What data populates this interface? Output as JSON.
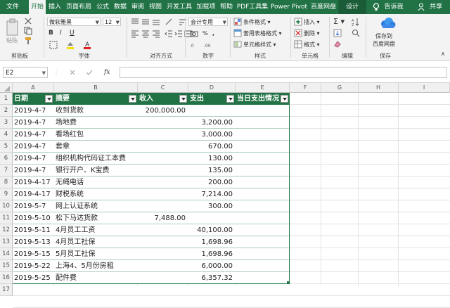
{
  "menu": {
    "tabs": [
      "文件",
      "开始",
      "插入",
      "页面布局",
      "公式",
      "数据",
      "审阅",
      "视图",
      "开发工具",
      "加载项",
      "帮助",
      "PDF工具集",
      "Power Pivot",
      "百度网盘",
      "设计"
    ],
    "tellme": "告诉我",
    "share": "共享"
  },
  "ribbon": {
    "clipboard": {
      "paste": "粘贴",
      "label": "剪贴板"
    },
    "font": {
      "name": "微软雅黑",
      "size": "12",
      "label": "字体"
    },
    "alignment": {
      "label": "对齐方式"
    },
    "number": {
      "format": "会计专用",
      "label": "数字"
    },
    "styles": {
      "conditional": "条件格式",
      "table": "套用表格格式",
      "cell": "单元格样式",
      "label": "样式"
    },
    "cells": {
      "insert": "插入",
      "delete": "删除",
      "format": "格式",
      "label": "单元格"
    },
    "editing": {
      "label": "编辑"
    },
    "save": {
      "line1": "保存到",
      "line2": "百度网盘",
      "label": "保存"
    }
  },
  "formula_bar": {
    "cell_ref": "E2",
    "fx": "fx",
    "value": ""
  },
  "columns": [
    "A",
    "B",
    "C",
    "D",
    "E",
    "F",
    "G",
    "H",
    "I"
  ],
  "rows": [
    "1",
    "2",
    "3",
    "4",
    "5",
    "6",
    "7",
    "8",
    "9",
    "10",
    "11",
    "12",
    "13",
    "14",
    "15",
    "16",
    "17"
  ],
  "table": {
    "headers": [
      "日期",
      "摘要",
      "收入",
      "支出",
      "当日支出情况"
    ],
    "data": [
      [
        "2019-4-7",
        "收到货款",
        "200,000.00",
        ""
      ],
      [
        "2019-4-7",
        "场地费",
        "",
        "3,200.00"
      ],
      [
        "2019-4-7",
        "看场红包",
        "",
        "3,000.00"
      ],
      [
        "2019-4-7",
        "套章",
        "",
        "670.00"
      ],
      [
        "2019-4-7",
        "组织机构代码证工本费",
        "",
        "130.00"
      ],
      [
        "2019-4-7",
        "银行开户、K宝费",
        "",
        "135.00"
      ],
      [
        "2019-4-17",
        "无绳电话",
        "",
        "200.00"
      ],
      [
        "2019-4-17",
        "财税系统",
        "",
        "7,214.00"
      ],
      [
        "2019-5-7",
        "网上认证系统",
        "",
        "300.00"
      ],
      [
        "2019-5-10",
        "松下马达货款",
        "7,488.00",
        ""
      ],
      [
        "2019-5-11",
        "4月员工工资",
        "",
        "40,100.00"
      ],
      [
        "2019-5-13",
        "4月员工社保",
        "",
        "1,698.96"
      ],
      [
        "2019-5-15",
        "5月员工社保",
        "",
        "1,698.96"
      ],
      [
        "2019-5-22",
        "上海4、5月份房租",
        "",
        "6,000.00"
      ],
      [
        "2019-5-25",
        "配件费",
        "",
        "6,357.32"
      ]
    ]
  },
  "colors": {
    "accent": "#217346",
    "header_fill": "#217346",
    "header_text": "#ffffff"
  }
}
